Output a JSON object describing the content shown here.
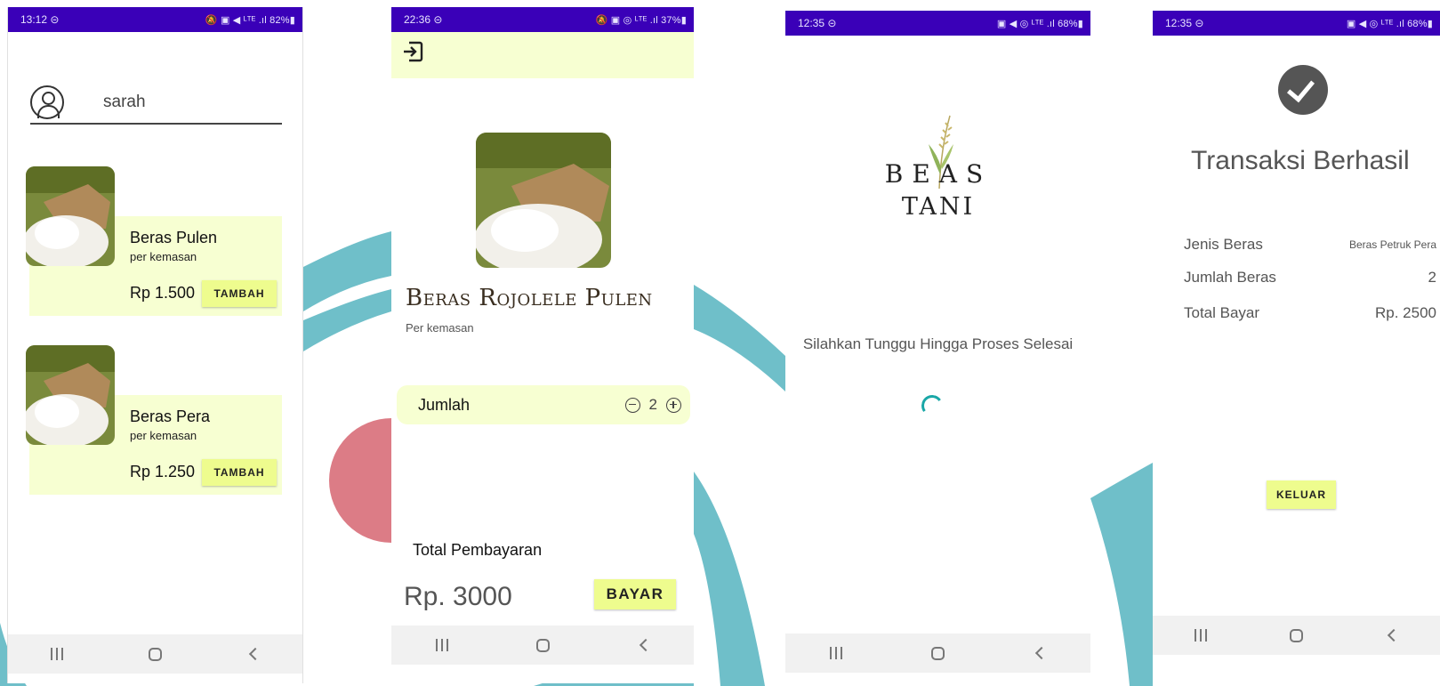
{
  "colors": {
    "status_bar": "#3a00b8",
    "card_bg": "#f7ffd2",
    "button_bg": "#eefc8e",
    "decor_teal": "#6fbfc9",
    "decor_pink": "#dc7c86"
  },
  "screen1": {
    "status": {
      "time": "13:12 ⊝",
      "icons": "🔕 ▣ ◀ ᴸᵀᴱ .ıl 82%▮"
    },
    "username": "sarah",
    "products": [
      {
        "name": "Beras Pulen",
        "sub": "per kemasan",
        "price": "Rp 1.500",
        "button": "TAMBAH"
      },
      {
        "name": "Beras Pera",
        "sub": "per kemasan",
        "price": "Rp 1.250",
        "button": "TAMBAH"
      }
    ]
  },
  "screen2": {
    "status": {
      "time": "22:36 ⊝",
      "icons": "🔕 ▣ ◎ ᴸᵀᴱ .ıl 37%▮"
    },
    "title": "Beras Rojolele Pulen",
    "subtitle": "Per kemasan",
    "qty_label": "Jumlah",
    "qty_value": "2",
    "total_label": "Total Pembayaran",
    "total_value": "Rp. 3000",
    "pay_button": "BAYAR"
  },
  "screen3": {
    "status": {
      "time": "12:35 ⊝",
      "icons": "▣ ◀ ◎ ᴸᵀᴱ .ıl 68%▮"
    },
    "logo_line1": "BEAS",
    "logo_line2": "TANI",
    "wait_text": "Silahkan Tunggu Hingga Proses Selesai"
  },
  "screen4": {
    "status": {
      "time": "12:35 ⊝",
      "icons": "▣ ◀ ◎ ᴸᵀᴱ .ıl 68%▮"
    },
    "title": "Transaksi Berhasil",
    "rows": [
      {
        "label": "Jenis Beras",
        "value": "Beras Petruk Pera"
      },
      {
        "label": "Jumlah Beras",
        "value": "2"
      },
      {
        "label": "Total Bayar",
        "value": "Rp. 2500"
      }
    ],
    "exit_button": "KELUAR"
  }
}
